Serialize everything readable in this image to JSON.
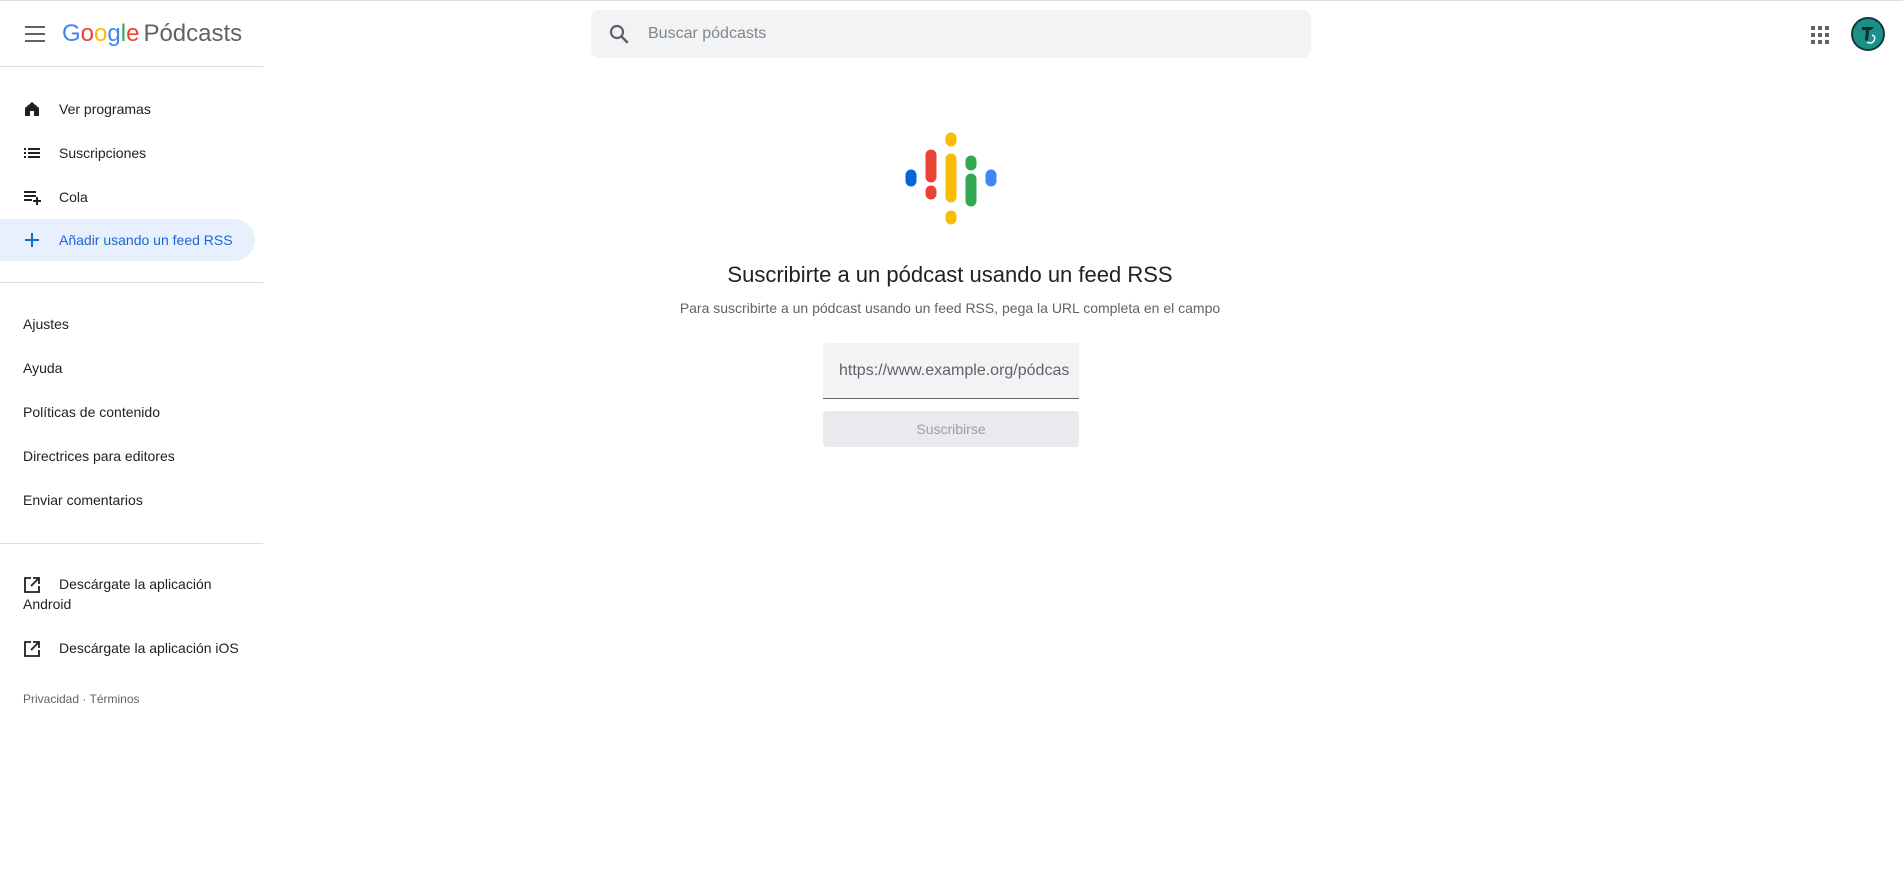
{
  "header": {
    "brand_letters": [
      {
        "char": "G",
        "color": "#4285F4"
      },
      {
        "char": "o",
        "color": "#EA4335"
      },
      {
        "char": "o",
        "color": "#FBBC05"
      },
      {
        "char": "g",
        "color": "#4285F4"
      },
      {
        "char": "l",
        "color": "#34A853"
      },
      {
        "char": "e",
        "color": "#EA4335"
      }
    ],
    "product_name": "Pódcasts",
    "menu_icon": "hamburger-menu-icon",
    "apps_icon": "google-apps-grid-icon",
    "avatar_icon": "user-avatar"
  },
  "search": {
    "placeholder": "Buscar pódcasts",
    "value": "",
    "icon": "search-icon"
  },
  "sidebar": {
    "nav": [
      {
        "label": "Ver programas",
        "icon": "home-icon",
        "active": false
      },
      {
        "label": "Suscripciones",
        "icon": "list-icon",
        "active": false
      },
      {
        "label": "Cola",
        "icon": "playlist-add-icon",
        "active": false
      },
      {
        "label": "Añadir usando un feed RSS",
        "icon": "plus-icon",
        "active": true
      }
    ],
    "links": [
      {
        "label": "Ajustes"
      },
      {
        "label": "Ayuda"
      },
      {
        "label": "Políticas de contenido"
      },
      {
        "label": "Directrices para editores"
      },
      {
        "label": "Enviar comentarios"
      }
    ],
    "external": [
      {
        "label": "Descárgate la aplicación Android",
        "icon": "open-in-new-icon"
      },
      {
        "label": "Descárgate la aplicación iOS",
        "icon": "open-in-new-icon"
      }
    ],
    "legal": {
      "privacy": "Privacidad",
      "separator": "·",
      "terms": "Términos"
    }
  },
  "main": {
    "logo_icon": "google-podcasts-logo",
    "title": "Suscribirte a un pódcast usando un feed RSS",
    "subtitle": "Para suscribirte a un pódcast usando un feed RSS, pega la URL completa en el campo",
    "rss_input": {
      "placeholder": "https://www.example.org/pódcast",
      "value": ""
    },
    "subscribe_label": "Suscribirse"
  },
  "colors": {
    "accent": "#1967d2",
    "active_bg": "#e8f0fe",
    "blue": "#4285F4",
    "red": "#EA4335",
    "yellow": "#FBBC04",
    "green": "#34A853"
  }
}
